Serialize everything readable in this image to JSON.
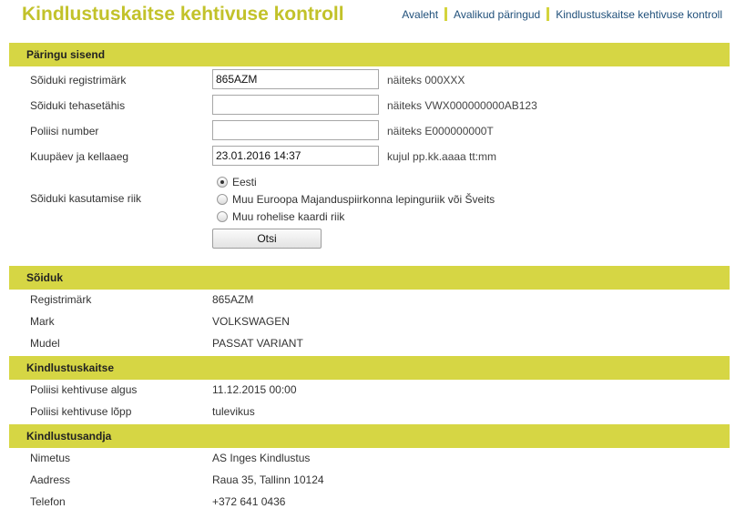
{
  "header": {
    "title": "Kindlustuskaitse kehtivuse kontroll",
    "nav": [
      {
        "label": "Avaleht"
      },
      {
        "label": "Avalikud päringud"
      },
      {
        "label": "Kindlustuskaitse kehtivuse kontroll"
      }
    ]
  },
  "query": {
    "section_title": "Päringu sisend",
    "reg_label": "Sõiduki registrimärk",
    "reg_value": "865AZM",
    "reg_hint": "näiteks 000XXX",
    "vin_label": "Sõiduki tehasetähis",
    "vin_value": "",
    "vin_hint": "näiteks VWX000000000AB123",
    "policy_label": "Poliisi number",
    "policy_value": "",
    "policy_hint": "näiteks E000000000T",
    "datetime_label": "Kuupäev ja kellaaeg",
    "datetime_value": "23.01.2016 14:37",
    "datetime_hint": "kujul pp.kk.aaaa tt:mm",
    "country_label": "Sõiduki kasutamise riik",
    "country_options": [
      {
        "label": "Eesti",
        "checked": true
      },
      {
        "label": "Muu Euroopa Majanduspiirkonna lepinguriik või Šveits",
        "checked": false
      },
      {
        "label": "Muu rohelise kaardi riik",
        "checked": false
      }
    ],
    "search_button": "Otsi"
  },
  "vehicle": {
    "section_title": "Sõiduk",
    "rows": [
      {
        "label": "Registrimärk",
        "value": "865AZM"
      },
      {
        "label": "Mark",
        "value": "VOLKSWAGEN"
      },
      {
        "label": "Mudel",
        "value": "PASSAT VARIANT"
      }
    ]
  },
  "coverage": {
    "section_title": "Kindlustuskaitse",
    "rows": [
      {
        "label": "Poliisi kehtivuse algus",
        "value": "11.12.2015 00:00"
      },
      {
        "label": "Poliisi kehtivuse lõpp",
        "value": "tulevikus"
      }
    ]
  },
  "insurer": {
    "section_title": "Kindlustusandja",
    "rows": [
      {
        "label": "Nimetus",
        "value": "AS Inges Kindlustus"
      },
      {
        "label": "Aadress",
        "value": "Raua 35, Tallinn 10124"
      },
      {
        "label": "Telefon",
        "value": "+372 641 0436"
      }
    ]
  }
}
